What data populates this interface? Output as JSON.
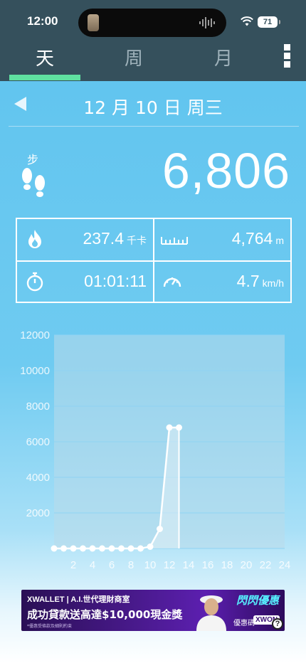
{
  "status_bar": {
    "time": "12:00",
    "battery": "71"
  },
  "tabs": [
    {
      "label": "天",
      "active": true
    },
    {
      "label": "周",
      "active": false
    },
    {
      "label": "月",
      "active": false
    }
  ],
  "date": {
    "label": "12 月 10 日 周三"
  },
  "steps": {
    "label": "步",
    "value": "6,806"
  },
  "stats": {
    "calories": {
      "value": "237.4",
      "unit": "千卡"
    },
    "distance": {
      "value": "4,764",
      "unit": "m"
    },
    "duration": {
      "value": "01:01:11"
    },
    "speed": {
      "value": "4.7",
      "unit": "km/h"
    }
  },
  "chart_data": {
    "type": "line",
    "y_ticks": [
      "2000",
      "4000",
      "6000",
      "8000",
      "10000",
      "12000"
    ],
    "x_ticks": [
      "2",
      "4",
      "6",
      "8",
      "10",
      "12",
      "14",
      "16",
      "18",
      "20",
      "22",
      "24"
    ],
    "ylim": [
      0,
      12000
    ],
    "xlim": [
      0,
      24
    ],
    "x": [
      0,
      1,
      2,
      3,
      4,
      5,
      6,
      7,
      8,
      9,
      10,
      11,
      12,
      13
    ],
    "values": [
      0,
      0,
      0,
      0,
      0,
      0,
      0,
      0,
      0,
      0,
      100,
      1100,
      6800,
      6800
    ],
    "grid": true,
    "colors": {
      "line": "#ffffff",
      "plot_bg": "#b9dbea"
    }
  },
  "ad": {
    "brand": "XWALLET | A.I.世代理財商室",
    "promo": "成功貸款送高達$10,000現金獎",
    "fine": "*優惠受條款及細則約束",
    "badge": "閃閃優惠",
    "code_label": "優惠碼",
    "code": "XWON"
  }
}
